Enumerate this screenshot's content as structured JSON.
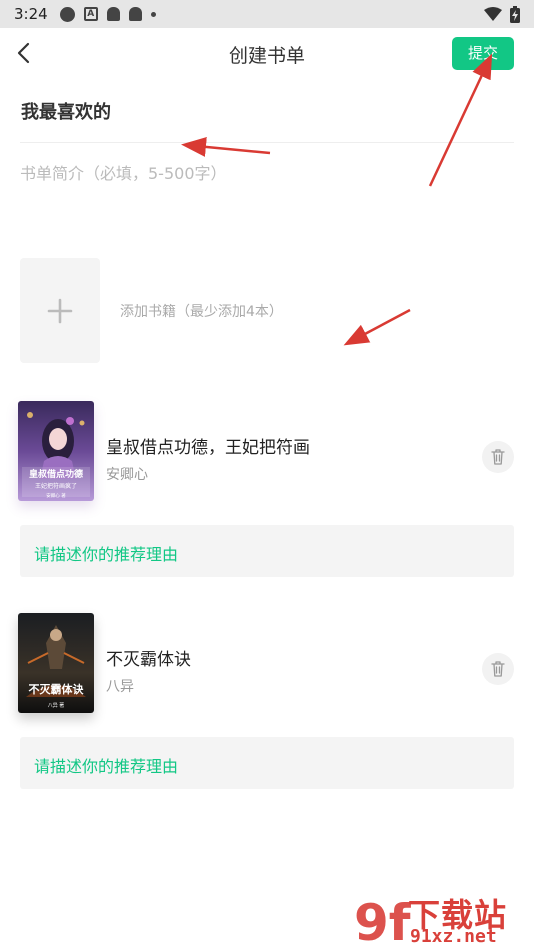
{
  "status_bar": {
    "time": "3:24",
    "icons": [
      "chrome-icon",
      "a-badge-icon",
      "android-icon",
      "android-icon",
      "dot-icon"
    ],
    "right_icons": [
      "wifi-icon",
      "battery-charging-icon"
    ]
  },
  "nav": {
    "title": "创建书单",
    "submit_label": "提交",
    "back_icon": "chevron-left-icon"
  },
  "form": {
    "list_name": "我最喜欢的",
    "description_value": "",
    "description_placeholder": "书单简介（必填，5-500字）",
    "add_books_hint": "添加书籍（最少添加4本）",
    "add_icon": "plus-icon"
  },
  "books": [
    {
      "title": "皇叔借点功德，王妃把符画",
      "author": "安卿心",
      "reason_placeholder": "请描述你的推荐理由",
      "cover_text": "皇叔借点功德",
      "cover_subtext": "王妃把符画疯了",
      "cover_author": "安卿心 著"
    },
    {
      "title": "不灭霸体诀",
      "author": "八异",
      "reason_placeholder": "请描述你的推荐理由",
      "cover_text": "不灭霸体诀",
      "cover_author": "八异 著"
    }
  ],
  "colors": {
    "accent": "#12c785",
    "annotation_arrow": "#d93a33",
    "watermark": "#d9403a"
  },
  "watermark": {
    "logo_text": "9f",
    "brand": "下载站",
    "url": "91xz.net"
  }
}
